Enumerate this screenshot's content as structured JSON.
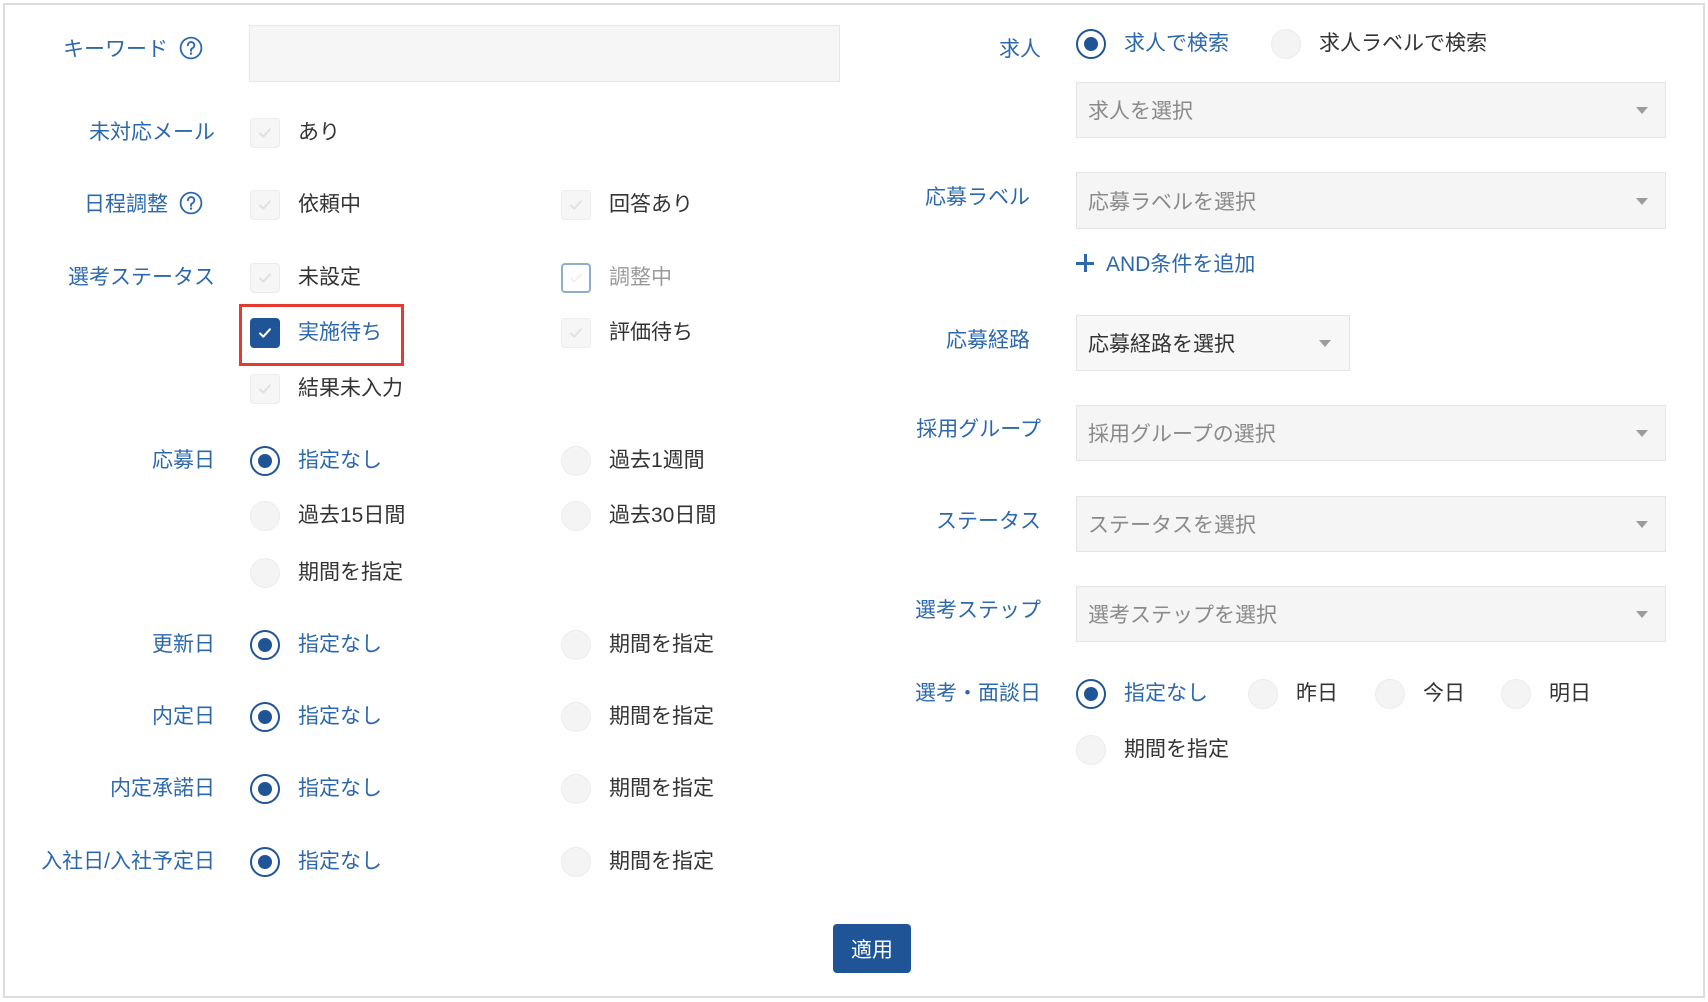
{
  "colors": {
    "label_blue": "#2c68ab",
    "accent": "#1f5596",
    "text": "#333333",
    "muted": "#9a9a9a",
    "highlight_red": "#e33b2f",
    "field_bg": "#f5f5f5",
    "border": "#e4e4e4"
  },
  "icons": {
    "help": "question-circle-icon",
    "check": "check-icon",
    "select_caret": "caret-down-icon",
    "add": "plus-icon"
  },
  "filters_left": {
    "keyword": {
      "label": "キーワード",
      "value": ""
    },
    "unreplied_mail": {
      "label": "未対応メール",
      "options": [
        {
          "label": "あり",
          "checked": false
        }
      ]
    },
    "scheduling": {
      "label": "日程調整",
      "options": [
        {
          "label": "依頼中",
          "checked": false
        },
        {
          "label": "回答あり",
          "checked": false
        }
      ]
    },
    "selection_status": {
      "label": "選考ステータス",
      "options": [
        {
          "label": "未設定",
          "checked": false
        },
        {
          "label": "調整中",
          "checked": false,
          "disabled": true
        },
        {
          "label": "実施待ち",
          "checked": true,
          "highlighted": true
        },
        {
          "label": "評価待ち",
          "checked": false
        },
        {
          "label": "結果未入力",
          "checked": false
        }
      ]
    },
    "applied_date": {
      "label": "応募日",
      "options": [
        {
          "label": "指定なし",
          "selected": true
        },
        {
          "label": "過去1週間",
          "selected": false
        },
        {
          "label": "過去15日間",
          "selected": false
        },
        {
          "label": "過去30日間",
          "selected": false
        },
        {
          "label": "期間を指定",
          "selected": false
        }
      ]
    },
    "updated_date": {
      "label": "更新日",
      "options": [
        {
          "label": "指定なし",
          "selected": true
        },
        {
          "label": "期間を指定",
          "selected": false
        }
      ]
    },
    "offer_date": {
      "label": "内定日",
      "options": [
        {
          "label": "指定なし",
          "selected": true
        },
        {
          "label": "期間を指定",
          "selected": false
        }
      ]
    },
    "offer_accepted_date": {
      "label": "内定承諾日",
      "options": [
        {
          "label": "指定なし",
          "selected": true
        },
        {
          "label": "期間を指定",
          "selected": false
        }
      ]
    },
    "join_date": {
      "label": "入社日/入社予定日",
      "options": [
        {
          "label": "指定なし",
          "selected": true
        },
        {
          "label": "期間を指定",
          "selected": false
        }
      ]
    }
  },
  "filters_right": {
    "job": {
      "label": "求人",
      "options": [
        {
          "label": "求人で検索",
          "selected": true
        },
        {
          "label": "求人ラベルで検索",
          "selected": false
        }
      ],
      "select_placeholder": "求人を選択"
    },
    "application_label": {
      "label": "応募ラベル",
      "select_placeholder": "応募ラベルを選択",
      "add_condition_label": "AND条件を追加"
    },
    "application_route": {
      "label": "応募経路",
      "select_placeholder": "応募経路を選択"
    },
    "hiring_group": {
      "label": "採用グループ",
      "select_placeholder": "採用グループの選択"
    },
    "status": {
      "label": "ステータス",
      "select_placeholder": "ステータスを選択"
    },
    "selection_step": {
      "label": "選考ステップ",
      "select_placeholder": "選考ステップを選択"
    },
    "interview_date": {
      "label": "選考・面談日",
      "options": [
        {
          "label": "指定なし",
          "selected": true
        },
        {
          "label": "昨日",
          "selected": false
        },
        {
          "label": "今日",
          "selected": false
        },
        {
          "label": "明日",
          "selected": false
        },
        {
          "label": "期間を指定",
          "selected": false
        }
      ]
    }
  },
  "apply_button": {
    "label": "適用"
  }
}
